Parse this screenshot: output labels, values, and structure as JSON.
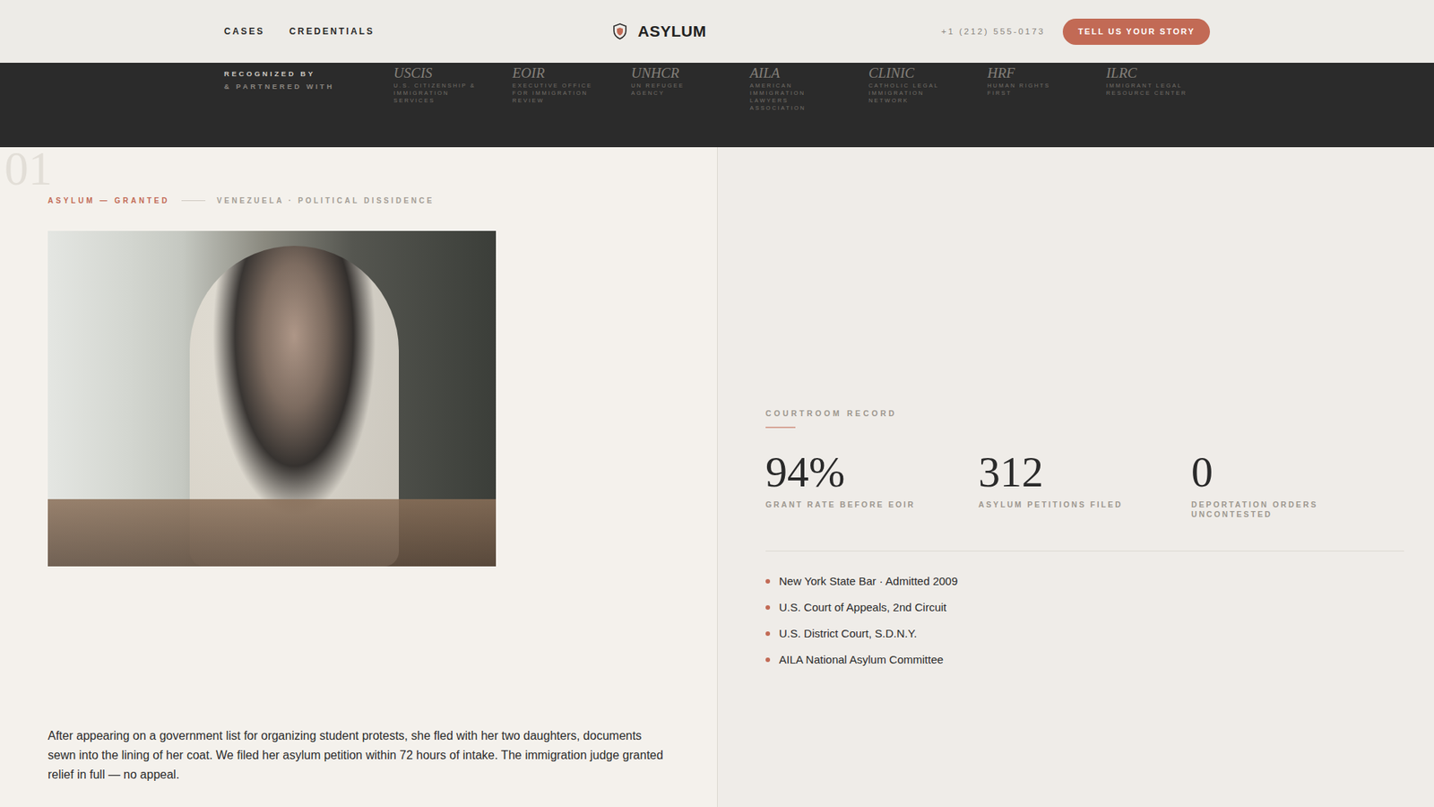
{
  "header": {
    "nav": [
      {
        "label": "CASES"
      },
      {
        "label": "CREDENTIALS"
      }
    ],
    "brand": "ASYLUM",
    "phone": "+1 (212) 555-0173",
    "cta": "TELL US YOUR STORY"
  },
  "partners": {
    "heading": [
      "RECOGNIZED BY",
      "& PARTNERED WITH"
    ],
    "items": [
      {
        "abbr": "USCIS",
        "name": "U.S. CITIZENSHIP & IMMIGRATION SERVICES"
      },
      {
        "abbr": "EOIR",
        "name": "EXECUTIVE OFFICE FOR IMMIGRATION REVIEW"
      },
      {
        "abbr": "UNHCR",
        "name": "UN REFUGEE AGENCY"
      },
      {
        "abbr": "AILA",
        "name": "AMERICAN IMMIGRATION LAWYERS ASSOCIATION"
      },
      {
        "abbr": "CLINIC",
        "name": "CATHOLIC LEGAL IMMIGRATION NETWORK"
      },
      {
        "abbr": "HRF",
        "name": "HUMAN RIGHTS FIRST"
      },
      {
        "abbr": "ILRC",
        "name": "IMMIGRANT LEGAL RESOURCE CENTER"
      }
    ]
  },
  "case": {
    "number": "01",
    "outcome": "ASYLUM — GRANTED",
    "origin": "VENEZUELA · POLITICAL DISSIDENCE",
    "story": "After appearing on a government list for organizing student protests, she fled with her two daughters, documents sewn into the lining of her coat. We filed her asylum petition within 72 hours of intake. The immigration judge granted relief in full — no appeal."
  },
  "record": {
    "title": "COURTROOM RECORD",
    "stats": [
      {
        "value": "94%",
        "label": "GRANT RATE BEFORE EOIR"
      },
      {
        "value": "312",
        "label": "ASYLUM PETITIONS FILED"
      },
      {
        "value": "0",
        "label": "DEPORTATION ORDERS UNCONTESTED"
      }
    ],
    "credentials": [
      "New York State Bar · Admitted 2009",
      "U.S. Court of Appeals, 2nd Circuit",
      "U.S. District Court, S.D.N.Y.",
      "AILA National Asylum Committee"
    ]
  }
}
